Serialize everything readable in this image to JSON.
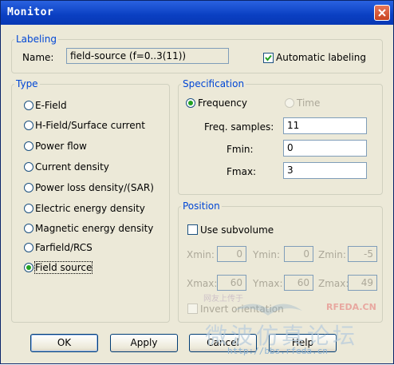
{
  "window": {
    "title": "Monitor"
  },
  "labeling": {
    "legend": "Labeling",
    "name_label": "Name:",
    "name_value": "field-source (f=0..3(11))",
    "auto_label": "Automatic labeling",
    "auto_checked": true
  },
  "type": {
    "legend": "Type",
    "selected": "Field source",
    "options": [
      "E-Field",
      "H-Field/Surface current",
      "Power flow",
      "Current density",
      "Power loss density/(SAR)",
      "Electric energy density",
      "Magnetic energy density",
      "Farfield/RCS",
      "Field source"
    ]
  },
  "specification": {
    "legend": "Specification",
    "frequency_label": "Frequency",
    "time_label": "Time",
    "selected": "Frequency",
    "samples_label": "Freq. samples:",
    "samples_value": "11",
    "fmin_label": "Fmin:",
    "fmin_value": "0",
    "fmax_label": "Fmax:",
    "fmax_value": "3"
  },
  "position": {
    "legend": "Position",
    "subvolume_label": "Use subvolume",
    "subvolume_checked": false,
    "xmin_label": "Xmin:",
    "xmin_value": "0",
    "ymin_label": "Ymin:",
    "ymin_value": "0",
    "zmin_label": "Zmin:",
    "zmin_value": "-5",
    "xmax_label": "Xmax:",
    "xmax_value": "60",
    "ymax_label": "Ymax:",
    "ymax_value": "60",
    "zmax_label": "Zmax:",
    "zmax_value": "49",
    "invert_label": "Invert orientation",
    "invert_checked": false
  },
  "buttons": {
    "ok": "OK",
    "apply": "Apply",
    "cancel": "Cancel",
    "help": "Help"
  },
  "watermark": {
    "brand": "RFEDA.CN",
    "cn_text": "微波仿真论坛",
    "cn_small": "网友上传于",
    "url": "http://bbs.rfeda.cn"
  },
  "colors": {
    "titlebar": "#0a3fc2",
    "legend": "#0046d5",
    "dialog_bg": "#ece9d8",
    "radio_selected": "#21a121"
  },
  "icons": {
    "close": "close-icon",
    "check": "checkmark-icon"
  }
}
